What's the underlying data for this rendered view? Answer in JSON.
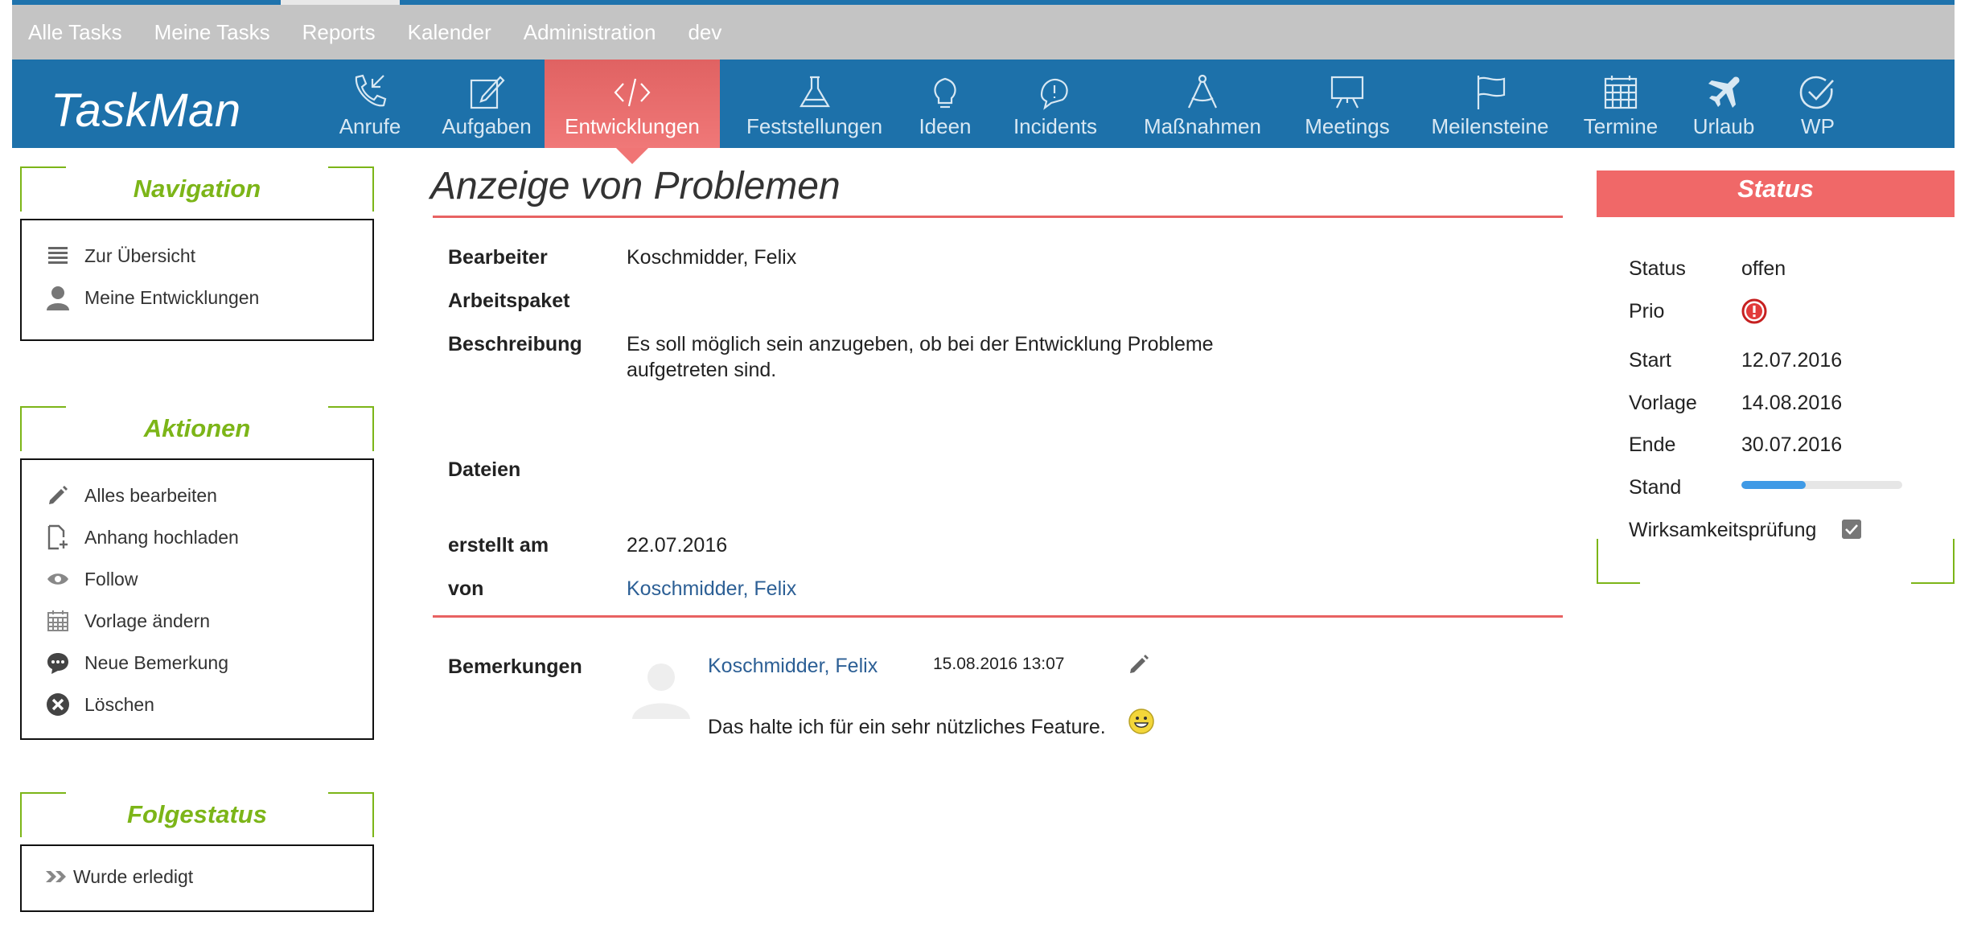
{
  "top_menu": {
    "items": [
      "Alle Tasks",
      "Meine Tasks",
      "Reports",
      "Kalender",
      "Administration",
      "dev"
    ]
  },
  "app": {
    "logo": "TaskMan",
    "nav": [
      {
        "label": "Anrufe",
        "icon": "phone-icon"
      },
      {
        "label": "Aufgaben",
        "icon": "edit-note-icon"
      },
      {
        "label": "Entwicklungen",
        "icon": "code-icon",
        "active": true
      },
      {
        "label": "Feststellungen",
        "icon": "flask-icon"
      },
      {
        "label": "Ideen",
        "icon": "lightbulb-icon"
      },
      {
        "label": "Incidents",
        "icon": "alert-bubble-icon"
      },
      {
        "label": "Maßnahmen",
        "icon": "compass-icon"
      },
      {
        "label": "Meetings",
        "icon": "presentation-board-icon"
      },
      {
        "label": "Meilensteine",
        "icon": "flag-icon"
      },
      {
        "label": "Termine",
        "icon": "calendar-icon"
      },
      {
        "label": "Urlaub",
        "icon": "airplane-icon"
      },
      {
        "label": "WP",
        "icon": "check-circle-icon"
      }
    ],
    "accent": "#1d71aa",
    "active_color": "#f07575"
  },
  "sidebar": {
    "navigation": {
      "title": "Navigation",
      "items": [
        {
          "label": "Zur Übersicht",
          "icon": "list-icon"
        },
        {
          "label": "Meine Entwicklungen",
          "icon": "user-icon"
        }
      ]
    },
    "actions": {
      "title": "Aktionen",
      "items": [
        {
          "label": "Alles bearbeiten",
          "icon": "pencil-icon"
        },
        {
          "label": "Anhang hochladen",
          "icon": "file-add-icon"
        },
        {
          "label": "Follow",
          "icon": "eye-icon"
        },
        {
          "label": "Vorlage ändern",
          "icon": "calendar-icon"
        },
        {
          "label": "Neue Bemerkung",
          "icon": "comment-icon"
        },
        {
          "label": "Löschen",
          "icon": "delete-circle-icon"
        }
      ]
    },
    "followup": {
      "title": "Folgestatus",
      "items": [
        {
          "label": "Wurde erledigt",
          "icon": "double-chevron-right-icon"
        }
      ]
    }
  },
  "main": {
    "title": "Anzeige von Problemen",
    "fields": {
      "bearbeiter_label": "Bearbeiter",
      "bearbeiter_value": "Koschmidder, Felix",
      "arbeitspaket_label": "Arbeitspaket",
      "beschreibung_label": "Beschreibung",
      "beschreibung_line1": "Es soll möglich sein anzugeben, ob bei der Entwicklung Probleme",
      "beschreibung_line2": "aufgetreten sind.",
      "dateien_label": "Dateien",
      "erstellt_label": "erstellt am",
      "erstellt_value": "22.07.2016",
      "von_label": "von",
      "von_value": "Koschmidder, Felix"
    },
    "comments": {
      "label": "Bemerkungen",
      "items": [
        {
          "author": "Koschmidder, Felix",
          "date": "15.08.2016 13:07",
          "text": "Das halte ich für ein sehr nützliches Feature."
        }
      ]
    }
  },
  "status_panel": {
    "title": "Status",
    "status_label": "Status",
    "status_value": "offen",
    "prio_label": "Prio",
    "start_label": "Start",
    "start_value": "12.07.2016",
    "vorlage_label": "Vorlage",
    "vorlage_value": "14.08.2016",
    "ende_label": "Ende",
    "ende_value": "30.07.2016",
    "stand_label": "Stand",
    "stand_progress": 0.4,
    "wirksamkeit_label": "Wirksamkeitsprüfung",
    "wirksamkeit_checked": true
  }
}
